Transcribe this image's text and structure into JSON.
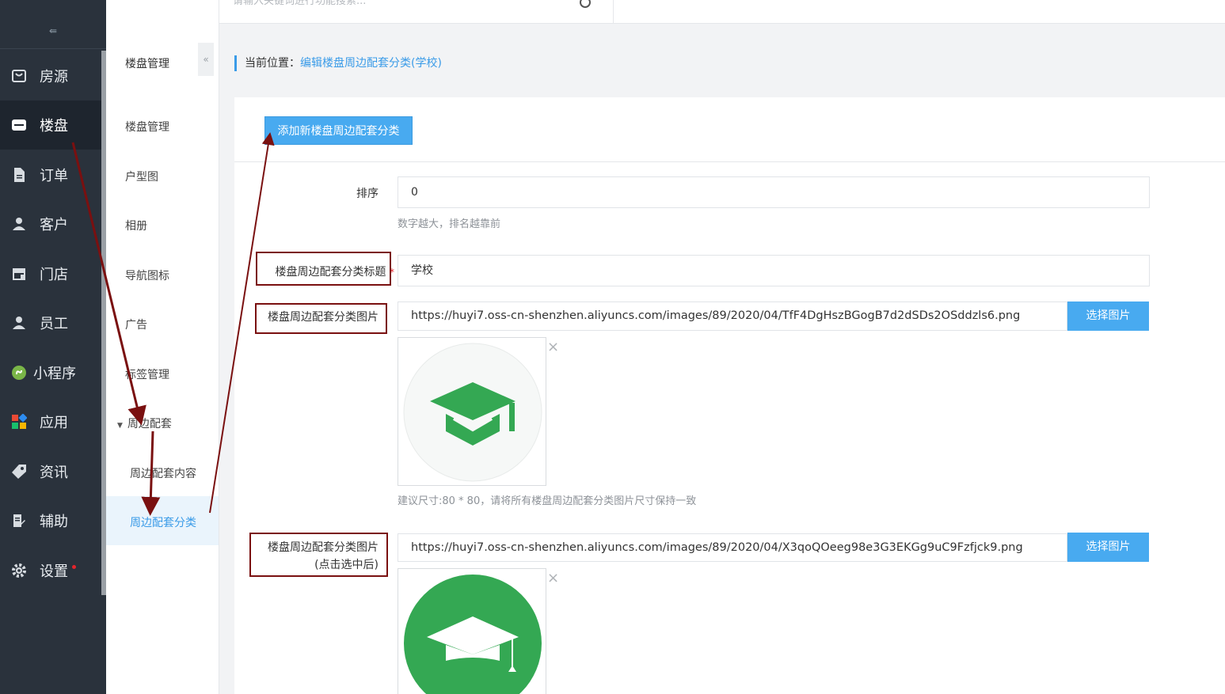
{
  "topbar": {
    "search_placeholder": "请输入关键词进行功能搜索..."
  },
  "leftnav": {
    "items": [
      {
        "label": "房源",
        "icon": "store-bag-icon"
      },
      {
        "label": "楼盘",
        "icon": "building-icon"
      },
      {
        "label": "订单",
        "icon": "document-icon"
      },
      {
        "label": "客户",
        "icon": "user-icon"
      },
      {
        "label": "门店",
        "icon": "shop-icon"
      },
      {
        "label": "员工",
        "icon": "user-icon"
      },
      {
        "label": "小程序",
        "icon": "miniprogram-icon"
      },
      {
        "label": "应用",
        "icon": "apps-icon"
      },
      {
        "label": "资讯",
        "icon": "tag-icon"
      },
      {
        "label": "辅助",
        "icon": "edit-doc-icon"
      },
      {
        "label": "设置",
        "icon": "gear-icon"
      }
    ],
    "collapse_glyph": "⇚"
  },
  "subnav": {
    "heading": "楼盘管理",
    "collapse_glyph": "«",
    "items": [
      "楼盘管理",
      "户型图",
      "相册",
      "导航图标",
      "广告",
      "标签管理"
    ],
    "group": "周边配套",
    "group_children": [
      "周边配套内容",
      "周边配套分类"
    ]
  },
  "breadcrumb": {
    "prefix": "当前位置：",
    "current": "编辑楼盘周边配套分类(学校)"
  },
  "form": {
    "add_button": "添加新楼盘周边配套分类",
    "sort_label": "排序",
    "sort_value": "0",
    "sort_hint": "数字越大，排名越靠前",
    "title_label": "楼盘周边配套分类标题",
    "title_required": "*",
    "title_value": "学校",
    "image_label": "楼盘周边配套分类图片",
    "image_url": "https://huyi7.oss-cn-shenzhen.aliyuncs.com/images/89/2020/04/TfF4DgHszBGogB7d2dSDs2OSddzls6.png",
    "pick_button": "选择图片",
    "image_hint": "建议尺寸:80 * 80，请将所有楼盘周边配套分类图片尺寸保持一致",
    "image2_label_line1": "楼盘周边配套分类图片",
    "image2_label_line2": "(点击选中后)",
    "image2_url": "https://huyi7.oss-cn-shenzhen.aliyuncs.com/images/89/2020/04/X3qoQOeeg98e3G3EKGg9uC9Fzfjck9.png",
    "pick_button2": "选择图片",
    "close_glyph": "×"
  },
  "colors": {
    "accent": "#48aaf0",
    "nav_bg": "#2a323c",
    "annotation": "#7a1010",
    "icon_green": "#34a853"
  }
}
